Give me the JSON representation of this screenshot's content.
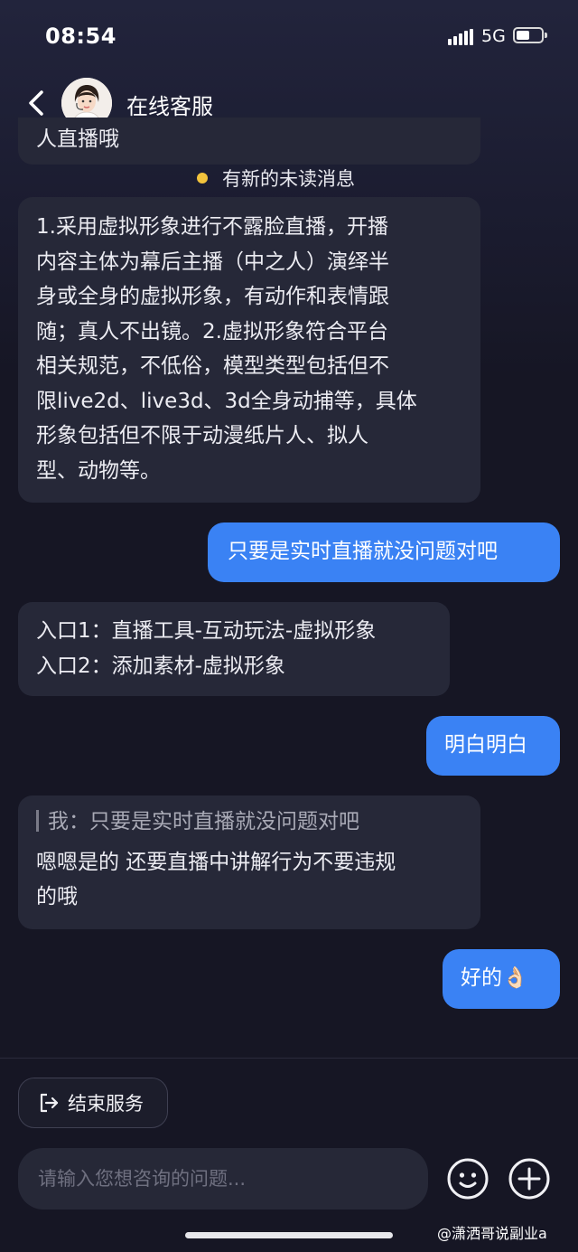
{
  "status_bar": {
    "time": "08:54",
    "network": "5G"
  },
  "header": {
    "title": "在线客服"
  },
  "notice": {
    "unread_text": "有新的未读消息",
    "dot_color": "#f2c33c"
  },
  "messages": {
    "m0": {
      "role": "agent",
      "lines": [
        "人直播哦"
      ]
    },
    "m1": {
      "role": "agent",
      "lines": [
        "1.采用虚拟形象进行不露脸直播，开播",
        "内容主体为幕后主播（中之人）演绎半",
        "身或全身的虚拟形象，有动作和表情跟",
        "随；真人不出镜。2.虚拟形象符合平台",
        "相关规范，不低俗，模型类型包括但不",
        "限live2d、live3d、3d全身动捕等，具体",
        "形象包括但不限于动漫纸片人、拟人",
        "型、动物等。"
      ]
    },
    "m2": {
      "role": "user",
      "lines": [
        "只要是实时直播就没问题对吧"
      ]
    },
    "m3": {
      "role": "agent",
      "lines": [
        "入口1：直播工具-互动玩法-虚拟形象",
        "入口2：添加素材-虚拟形象"
      ]
    },
    "m4": {
      "role": "user",
      "lines": [
        "明白明白"
      ]
    },
    "m5": {
      "role": "agent",
      "quote": "我：只要是实时直播就没问题对吧",
      "lines": [
        "嗯嗯是的 还要直播中讲解行为不要违规",
        "的哦"
      ]
    },
    "m6": {
      "role": "user",
      "lines": [
        "好的👌🏻"
      ]
    }
  },
  "footer": {
    "end_service_label": "结束服务",
    "input_placeholder": "请输入您想咨询的问题...",
    "emoji_icon": "smiley-icon",
    "plus_icon": "plus-icon"
  },
  "watermark": "@潇洒哥说副业a",
  "colors": {
    "background": "#161624",
    "agent_bubble": "#262838",
    "user_bubble": "#3a82f4"
  }
}
